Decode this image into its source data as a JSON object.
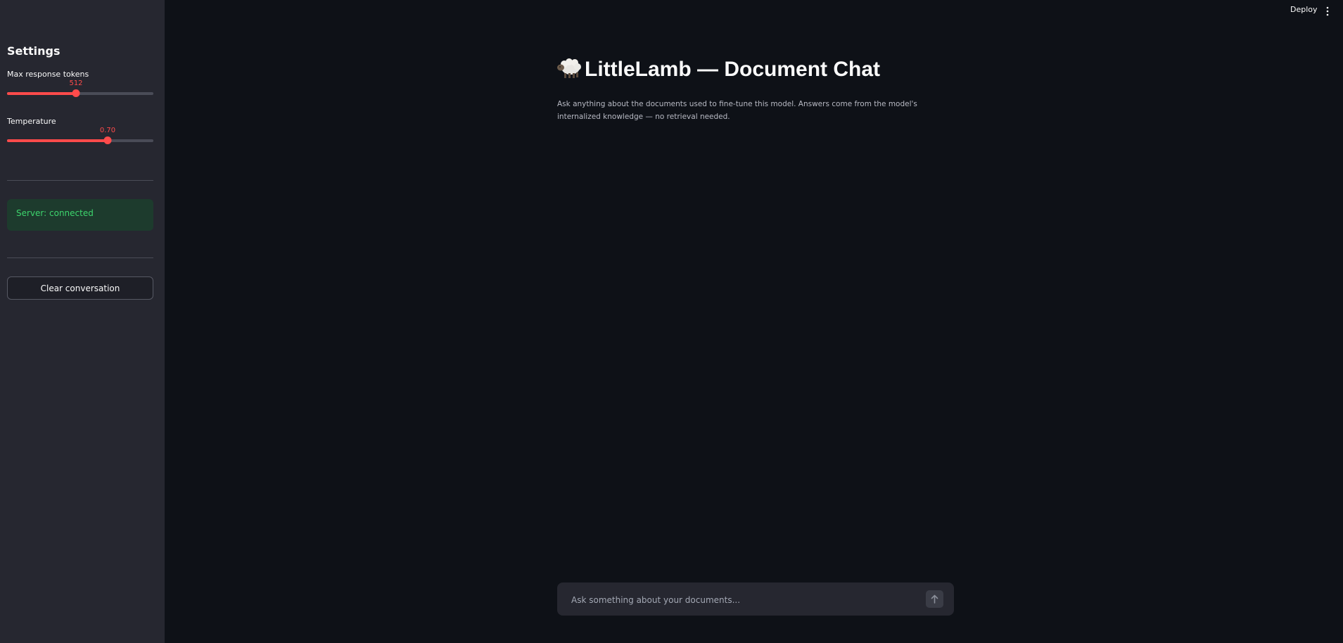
{
  "header": {
    "deploy_label": "Deploy",
    "menu_icon": "kebab-menu-icon"
  },
  "sidebar": {
    "title": "Settings",
    "sliders": [
      {
        "label": "Max response tokens",
        "value_text": "512",
        "fraction": 0.47
      },
      {
        "label": "Temperature",
        "value_text": "0.70",
        "fraction": 0.69
      }
    ],
    "status_text": "Server: connected",
    "clear_button_label": "Clear conversation"
  },
  "main": {
    "title_icon": "sheep-icon",
    "title": "LittleLamb — Document Chat",
    "subtitle": "Ask anything about the documents used to fine-tune this model. Answers come from the model's internalized knowledge — no retrieval needed.",
    "chat_placeholder": "Ask something about your documents...",
    "send_icon": "arrow-up-icon"
  },
  "colors": {
    "accent": "#ff4b4b",
    "background": "#0e1117",
    "sidebar": "#262730",
    "success_bg": "#1d3b2d",
    "success_text": "#3dd56d"
  }
}
